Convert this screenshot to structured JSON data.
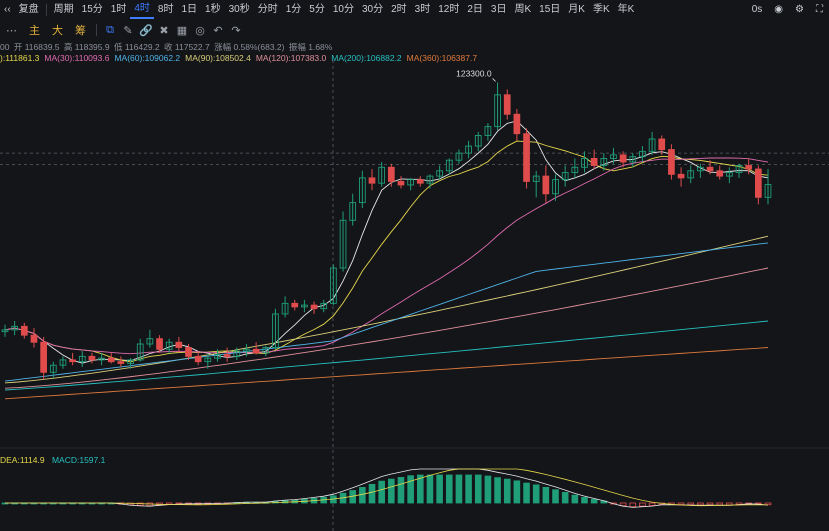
{
  "toolbar": {
    "back_icon": "chevrons-left-icon",
    "restore_label": "复盘",
    "period_label": "周期",
    "intervals": [
      "15分",
      "1时",
      "4时",
      "8时",
      "1日",
      "1秒",
      "30秒",
      "分时",
      "1分",
      "5分",
      "10分",
      "30分",
      "2时",
      "3时",
      "12时",
      "2日",
      "3日",
      "周K",
      "15日",
      "月K",
      "季K",
      "年K"
    ],
    "active_interval": "4时",
    "clock_label": "0s",
    "icons": [
      "camera-icon",
      "settings-icon",
      "fullscreen-icon"
    ]
  },
  "row2": {
    "menu_icon": "more-icon",
    "main_label": "主",
    "big_label": "大",
    "chip_label": "筹",
    "tools": [
      "select-icon",
      "pen-icon",
      "link-icon",
      "delete-icon",
      "layout-icon",
      "eye-icon",
      "undo-icon",
      "redo-icon"
    ]
  },
  "ohlc": {
    "prefix": "00",
    "open": "开 116839.5",
    "high": "高 118395.9",
    "low": "低 116429.2",
    "close": "收 117522.7",
    "change": "涨幅 0.58%(683.2)",
    "amplitude": "振幅 1.68%"
  },
  "ma": [
    {
      "label": "):111861.3",
      "color": "#e6d84a"
    },
    {
      "label": "MA(30):110093.6",
      "color": "#e06bb0"
    },
    {
      "label": "MA(60):109062.2",
      "color": "#4fb3e8"
    },
    {
      "label": "MA(90):108502.4",
      "color": "#d9cf7a"
    },
    {
      "label": "MA(120):107383.0",
      "color": "#e0909a"
    },
    {
      "label": "MA(200):106882.2",
      "color": "#26c0c0"
    },
    {
      "label": "MA(360):106387.7",
      "color": "#e07a3c"
    }
  ],
  "macd": {
    "dea_label": "DEA:1114.9",
    "macd_label": "MACD:1597.1",
    "dea_color": "#e6d84a",
    "macd_color": "#26c0c0"
  },
  "chart_data": {
    "type": "candlestick",
    "annotation": "123300.0",
    "colors": {
      "up": "#1f9e78",
      "down": "#e04c4c"
    },
    "candles": [
      [
        109200,
        109600,
        108900,
        109300
      ],
      [
        109300,
        109800,
        109000,
        109500
      ],
      [
        109500,
        109700,
        108800,
        109000
      ],
      [
        109000,
        109400,
        108300,
        108600
      ],
      [
        108600,
        108900,
        106500,
        106900
      ],
      [
        106900,
        107500,
        106600,
        107300
      ],
      [
        107300,
        107800,
        107100,
        107600
      ],
      [
        107600,
        108000,
        107300,
        107500
      ],
      [
        107500,
        108100,
        107200,
        107800
      ],
      [
        107800,
        108000,
        107400,
        107600
      ],
      [
        107600,
        108000,
        107300,
        107700
      ],
      [
        107700,
        108000,
        107400,
        107500
      ],
      [
        107500,
        107800,
        107200,
        107400
      ],
      [
        107400,
        107700,
        107100,
        107600
      ],
      [
        107600,
        108800,
        107500,
        108500
      ],
      [
        108500,
        109300,
        108300,
        108800
      ],
      [
        108800,
        109000,
        108000,
        108200
      ],
      [
        108200,
        108800,
        108000,
        108600
      ],
      [
        108600,
        108900,
        108000,
        108300
      ],
      [
        108300,
        108500,
        107600,
        107800
      ],
      [
        107800,
        108100,
        107300,
        107500
      ],
      [
        107500,
        107900,
        107100,
        107700
      ],
      [
        107700,
        108200,
        107500,
        107900
      ],
      [
        107900,
        108300,
        107500,
        107800
      ],
      [
        107800,
        108300,
        107600,
        108100
      ],
      [
        108100,
        108500,
        107800,
        108200
      ],
      [
        108200,
        108600,
        107900,
        108000
      ],
      [
        108000,
        108400,
        107800,
        108300
      ],
      [
        108300,
        110500,
        108200,
        110200
      ],
      [
        110200,
        111200,
        110000,
        110800
      ],
      [
        110800,
        111000,
        110400,
        110600
      ],
      [
        110600,
        111000,
        110300,
        110700
      ],
      [
        110700,
        110900,
        110200,
        110500
      ],
      [
        110500,
        111000,
        110300,
        110800
      ],
      [
        110800,
        113000,
        110700,
        112800
      ],
      [
        112800,
        116000,
        112600,
        115500
      ],
      [
        115500,
        117000,
        115200,
        116500
      ],
      [
        116500,
        118300,
        116200,
        117900
      ],
      [
        117900,
        118400,
        117200,
        117600
      ],
      [
        117600,
        118800,
        117400,
        118500
      ],
      [
        118500,
        118700,
        117400,
        117700
      ],
      [
        117700,
        118000,
        117300,
        117500
      ],
      [
        117500,
        117900,
        117200,
        117800
      ],
      [
        117800,
        118000,
        117400,
        117600
      ],
      [
        117600,
        118100,
        117300,
        118000
      ],
      [
        118000,
        118600,
        117800,
        118300
      ],
      [
        118300,
        119000,
        118100,
        118900
      ],
      [
        118900,
        119500,
        118700,
        119300
      ],
      [
        119300,
        120000,
        119000,
        119700
      ],
      [
        119700,
        120500,
        119400,
        120300
      ],
      [
        120300,
        121000,
        120000,
        120800
      ],
      [
        120800,
        123300,
        120600,
        122600
      ],
      [
        122600,
        122900,
        121200,
        121500
      ],
      [
        121500,
        121800,
        120000,
        120400
      ],
      [
        120400,
        120700,
        117300,
        117700
      ],
      [
        117700,
        118300,
        116800,
        118000
      ],
      [
        118000,
        118600,
        116500,
        117000
      ],
      [
        117000,
        118100,
        116600,
        117800
      ],
      [
        117800,
        118600,
        117400,
        118200
      ],
      [
        118200,
        119000,
        117900,
        118500
      ],
      [
        118500,
        119400,
        118200,
        119000
      ],
      [
        119000,
        119500,
        118400,
        118600
      ],
      [
        118600,
        119300,
        118300,
        119000
      ],
      [
        119000,
        119600,
        118700,
        119200
      ],
      [
        119200,
        119400,
        118500,
        118800
      ],
      [
        118800,
        119300,
        118500,
        119100
      ],
      [
        119100,
        119700,
        118800,
        119400
      ],
      [
        119400,
        120500,
        119200,
        120100
      ],
      [
        120100,
        120300,
        119200,
        119500
      ],
      [
        119500,
        119800,
        117800,
        118100
      ],
      [
        118100,
        118500,
        117400,
        117900
      ],
      [
        117900,
        118600,
        117600,
        118300
      ],
      [
        118300,
        118700,
        117900,
        118500
      ],
      [
        118500,
        118900,
        118100,
        118300
      ],
      [
        118300,
        118600,
        117800,
        118000
      ],
      [
        118000,
        118500,
        117600,
        118200
      ],
      [
        118200,
        118700,
        117900,
        118600
      ],
      [
        118600,
        119000,
        118100,
        118400
      ],
      [
        118400,
        118600,
        116400,
        116800
      ],
      [
        116800,
        118400,
        116400,
        117523
      ]
    ],
    "ylim": [
      104200,
      124400
    ]
  }
}
